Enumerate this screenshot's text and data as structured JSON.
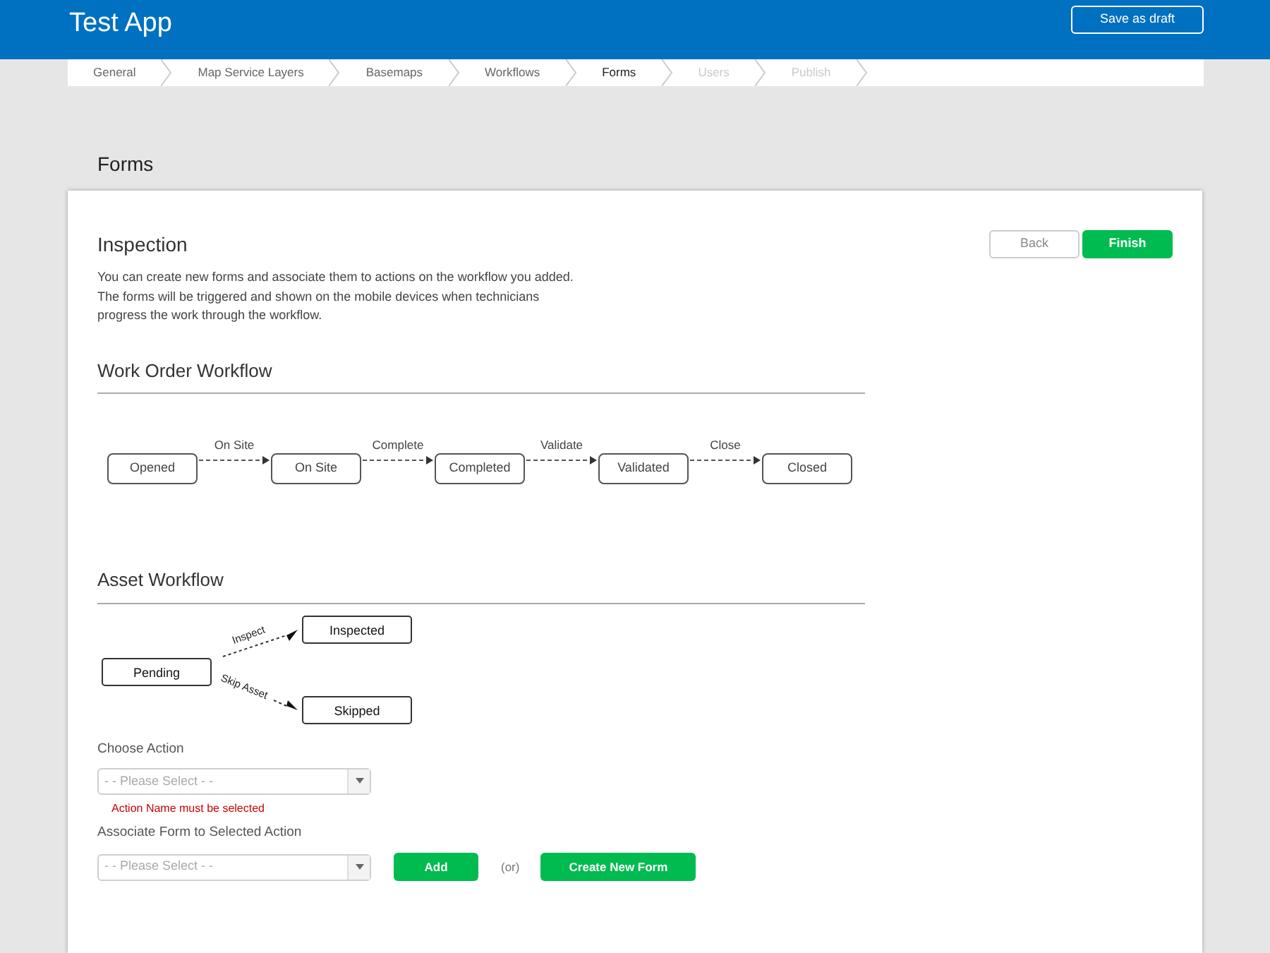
{
  "header": {
    "title": "Test App",
    "save_button": "Save as draft"
  },
  "steps": [
    {
      "label": "General",
      "selected": false,
      "disabled": false
    },
    {
      "label": "Map Service Layers",
      "selected": false,
      "disabled": false
    },
    {
      "label": "Basemaps",
      "selected": false,
      "disabled": false
    },
    {
      "label": "Workflows",
      "selected": false,
      "disabled": false
    },
    {
      "label": "Forms",
      "selected": true,
      "disabled": false
    },
    {
      "label": "Users",
      "selected": false,
      "disabled": true
    },
    {
      "label": "Publish",
      "selected": false,
      "disabled": true
    }
  ],
  "page_title": "Forms",
  "card": {
    "title": "Inspection",
    "description": "You can create new forms and associate them to actions on the workflow you added. The forms will be triggered and shown on the mobile devices when technicians progress the work through the workflow.",
    "buttons": [
      {
        "label": "Back",
        "kind": "secondary"
      },
      {
        "label": "Finish",
        "kind": "primary"
      }
    ]
  },
  "work_order_workflow": {
    "title": "Work Order Workflow",
    "states": [
      "Opened",
      "On Site",
      "Completed",
      "Validated",
      "Closed"
    ],
    "transitions": [
      "On Site",
      "Complete",
      "Validate",
      "Close"
    ]
  },
  "asset_workflow": {
    "title": "Asset Workflow",
    "start": "Pending",
    "branches": [
      {
        "transition": "Inspect",
        "target": "Inspected"
      },
      {
        "transition": "Skip Asset",
        "target": "Skipped"
      }
    ]
  },
  "choose_action": {
    "label": "Choose Action",
    "placeholder": "- - Please Select - -",
    "error": "Action Name must be selected"
  },
  "associate_form": {
    "label": "Associate Form to Selected Action",
    "placeholder": "- - Please Select - -",
    "add_button": "Add",
    "or": "(or)",
    "create_button": "Create New Form"
  }
}
